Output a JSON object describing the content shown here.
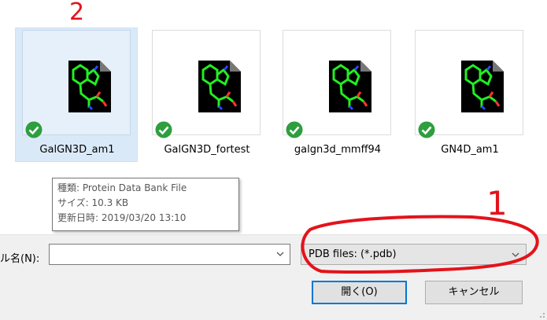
{
  "files": [
    {
      "name": "GalGN3D_am1",
      "selected": true
    },
    {
      "name": "GalGN3D_fortest",
      "selected": false
    },
    {
      "name": "galgn3d_mmff94",
      "selected": false
    },
    {
      "name": "GN4D_am1",
      "selected": false
    }
  ],
  "tooltip": {
    "type": "種類: Protein Data Bank File",
    "size": "サイズ: 10.3 KB",
    "modified": "更新日時: 2019/03/20 13:10"
  },
  "bottom": {
    "filename_label": "ル名(N):",
    "filename_value": "",
    "filetype_selected": "PDB files: (*.pdb)",
    "open_button": "開く(O)",
    "cancel_button": "キャンセル"
  },
  "annotations": {
    "mark_2": "2",
    "mark_1": "1"
  },
  "colors": {
    "selection": "#d9e9f7",
    "check_green": "#2e9e3e",
    "annotation_red": "#e3131b",
    "open_button_border": "#0078d7"
  }
}
